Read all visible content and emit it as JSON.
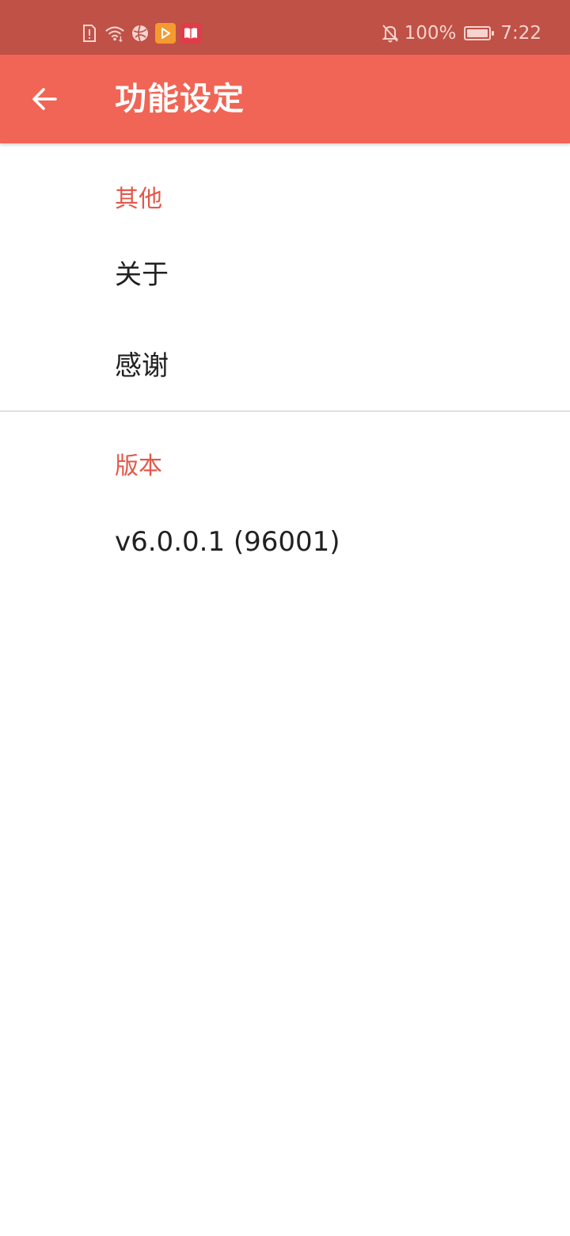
{
  "status_bar": {
    "left_icons": [
      "sim-alert-icon",
      "wifi-icon",
      "globe-icon",
      "play-app-icon",
      "reader-app-icon"
    ],
    "notification_icon": "bell-off-icon",
    "battery_text": "100%",
    "battery_level": 1.0,
    "time": "7:22"
  },
  "toolbar": {
    "back_icon": "arrow-back-icon",
    "title": "功能设定",
    "color": "#f06555"
  },
  "sections": [
    {
      "header": "其他",
      "items": [
        {
          "label": "关于"
        },
        {
          "label": "感谢"
        }
      ]
    },
    {
      "header": "版本",
      "items": [
        {
          "label": "v6.0.0.1 (96001)"
        }
      ]
    }
  ],
  "colors": {
    "status_bar": "#bf5146",
    "accent": "#e2584a",
    "text_primary": "#212121"
  }
}
